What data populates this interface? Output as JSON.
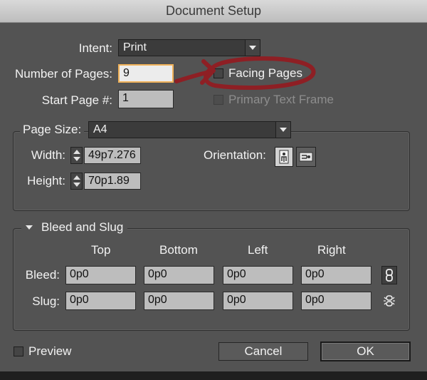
{
  "window": {
    "title": "Document Setup"
  },
  "intent": {
    "label": "Intent:",
    "value": "Print"
  },
  "pages": {
    "number_label": "Number of Pages:",
    "number_value": "9",
    "start_label": "Start Page #:",
    "start_value": "1",
    "facing_label": "Facing Pages",
    "primary_frame_label": "Primary Text Frame"
  },
  "page_size": {
    "label": "Page Size:",
    "value": "A4",
    "width_label": "Width:",
    "width_value": "49p7.276",
    "height_label": "Height:",
    "height_value": "70p1.89",
    "orientation_label": "Orientation:"
  },
  "bleed_slug": {
    "title": "Bleed and Slug",
    "columns": [
      "Top",
      "Bottom",
      "Left",
      "Right"
    ],
    "bleed_label": "Bleed:",
    "bleed_values": [
      "0p0",
      "0p0",
      "0p0",
      "0p0"
    ],
    "slug_label": "Slug:",
    "slug_values": [
      "0p0",
      "0p0",
      "0p0",
      "0p0"
    ]
  },
  "footer": {
    "preview_label": "Preview",
    "cancel_label": "Cancel",
    "ok_label": "OK"
  },
  "colors": {
    "annotation": "#8e1f24",
    "focus": "#f0b25a"
  }
}
